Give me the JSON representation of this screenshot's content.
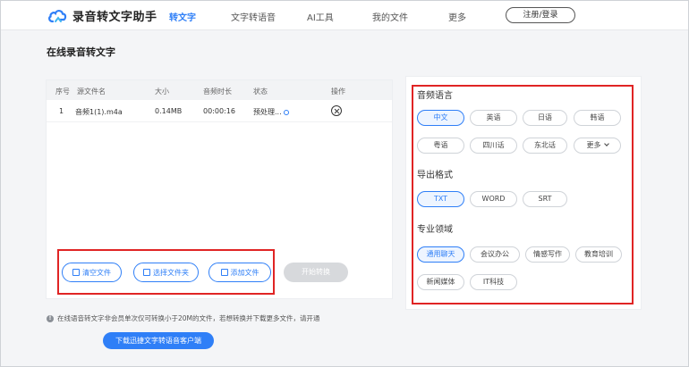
{
  "app": {
    "name": "录音转文字助手",
    "accent": "#2f7ff7",
    "highlight": "#e02424"
  },
  "nav": {
    "items": [
      "转文字",
      "文字转语音",
      "AI工具",
      "我的文件",
      "更多"
    ],
    "login": "注册/登录"
  },
  "page_title": "在线录音转文字",
  "table": {
    "headers": [
      "序号",
      "源文件名",
      "大小",
      "音频时长",
      "状态",
      "操作"
    ],
    "rows": [
      {
        "index": "1",
        "name": "音频1(1).m4a",
        "size": "0.14MB",
        "duration": "00:00:16",
        "status": "预处理..."
      }
    ]
  },
  "actions": {
    "clear": "清空文件",
    "choose_folder": "选择文件夹",
    "add_file": "添加文件",
    "start": "开始转换"
  },
  "notice": "在线语音转文字非会员单次仅可转换小于20M的文件，若想转换并下载更多文件，请开通",
  "download_client": "下载迅捷文字转语音客户端",
  "settings": {
    "language_title": "音频语言",
    "languages": [
      "中文",
      "英语",
      "日语",
      "韩语",
      "粤语",
      "四川话",
      "东北话",
      "更多"
    ],
    "format_title": "导出格式",
    "formats": [
      "TXT",
      "WORD",
      "SRT"
    ],
    "domain_title": "专业领域",
    "domains": [
      "通用聊天",
      "会议办公",
      "情感写作",
      "教育培训",
      "新闻媒体",
      "IT科技"
    ]
  }
}
